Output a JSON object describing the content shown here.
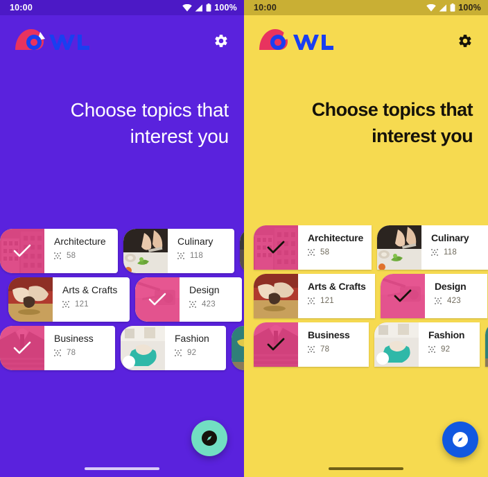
{
  "status_bar": {
    "time": "10:00",
    "battery_percent": "100%",
    "icons": [
      "wifi-icon",
      "signal-icon",
      "battery-icon"
    ]
  },
  "app_bar": {
    "brand_name": "OWL",
    "settings_icon": "gear-icon"
  },
  "headline": {
    "line1": "Choose topics that",
    "line2": "interest you"
  },
  "fab": {
    "icon": "explore-compass-icon"
  },
  "topics": {
    "rows": [
      [
        {
          "name": "Architecture",
          "count": "58",
          "selected": true,
          "image": "architecture-building-photo",
          "width_class": "w-a"
        },
        {
          "name": "Culinary",
          "count": "118",
          "selected": false,
          "image": "culinary-chopping-photo",
          "width_class": "w-b"
        }
      ],
      [
        {
          "name": "Arts & Crafts",
          "count": "121",
          "selected": false,
          "image": "pottery-hands-photo",
          "width_class": "w-c"
        },
        {
          "name": "Design",
          "count": "423",
          "selected": true,
          "image": "design-desk-photo",
          "width_class": "w-d"
        }
      ],
      [
        {
          "name": "Business",
          "count": "78",
          "selected": true,
          "image": "business-suit-photo",
          "width_class": "w-e"
        },
        {
          "name": "Fashion",
          "count": "92",
          "selected": false,
          "image": "fashion-fabric-photo",
          "width_class": "w-f"
        }
      ]
    ],
    "peek_cards": [
      {
        "image": "peek-card-photo-1"
      },
      {
        "image": "peek-card-photo-2"
      },
      {
        "image": "chalkboard-photo"
      }
    ],
    "course_count_icon": "grain-icon",
    "check_icon": "check-icon"
  },
  "theme": {
    "left_background": "#5A22DD",
    "left_statusbar": "#4C19C6",
    "left_title_color": "#FFFFFF",
    "left_fab": "#72DEC2",
    "right_background": "#F6DA50",
    "right_statusbar": "#C9AF34",
    "right_title_color": "#15120A",
    "right_fab": "#1158E0",
    "selected_tint": "#E6377F",
    "brand_blue": "#1a3ef0",
    "brand_pink": "#E8335F"
  }
}
